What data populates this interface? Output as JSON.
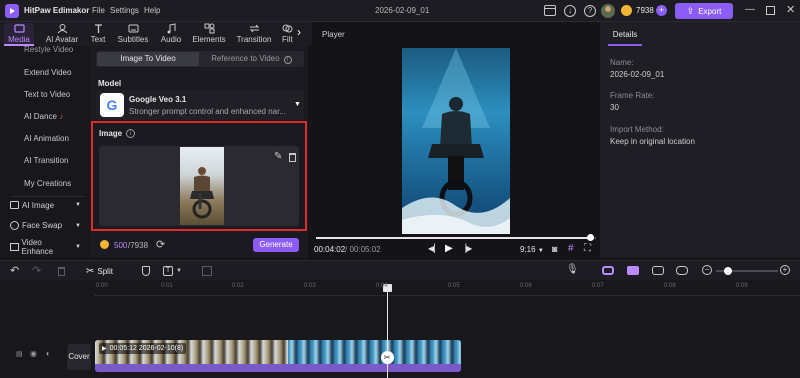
{
  "titlebar": {
    "app_name": "HitPaw Edimakor",
    "menus": [
      "File",
      "Settings",
      "Help"
    ],
    "project_title": "2026-02-09_01",
    "credits": "7938",
    "export_label": "Export"
  },
  "toolbar": {
    "items": [
      {
        "label": "Media",
        "icon": "media-icon",
        "active": true
      },
      {
        "label": "AI Avatar",
        "icon": "ai-avatar-icon"
      },
      {
        "label": "Text",
        "icon": "text-icon"
      },
      {
        "label": "Subtitles",
        "icon": "subtitles-icon"
      },
      {
        "label": "Audio",
        "icon": "audio-icon"
      },
      {
        "label": "Elements",
        "icon": "elements-icon"
      },
      {
        "label": "Transition",
        "icon": "transition-icon"
      },
      {
        "label": "Filt",
        "icon": "filter-icon"
      }
    ]
  },
  "leftnav": {
    "items": [
      "Restyle Video",
      "Extend Video",
      "Text to Video",
      "AI Dance",
      "AI Animation",
      "AI Transition",
      "My Creations"
    ],
    "dropdowns": [
      "AI Image",
      "Face Swap",
      "Video Enhance"
    ]
  },
  "aipanel": {
    "tabs": [
      "Image To Video",
      "Reference to Video"
    ],
    "model_heading": "Model",
    "model_name": "Google Veo 3.1",
    "model_desc": "Stronger prompt control and enhanced nar...",
    "image_heading": "Image",
    "credits_used": "500",
    "credits_total": "/7938",
    "generate_label": "Generate"
  },
  "player": {
    "title": "Player",
    "current_time": "00:04:02",
    "total_time": "/ 00:05:02",
    "aspect": "9:16",
    "progress_fraction": 0.98
  },
  "details": {
    "tab": "Details",
    "fields": [
      {
        "label": "Name:",
        "value": "2026-02-09_01"
      },
      {
        "label": "Frame Rate:",
        "value": "30"
      },
      {
        "label": "Import Method:",
        "value": "Keep in original location"
      }
    ]
  },
  "timeline": {
    "split_label": "Split",
    "ticks": [
      "0:00",
      "0:01",
      "0:02",
      "0:03",
      "0:04",
      "0:05",
      "0:06",
      "0:07",
      "0:08",
      "0:09"
    ],
    "cover_label": "Cover",
    "clip_label": "00:05:12   2026-02-10(8)",
    "playhead_fraction": 0.81,
    "zoom_fraction": 0.2
  },
  "colors": {
    "accent": "#8b5cf6",
    "highlight_border": "#e02b2b",
    "background": "#141418"
  }
}
